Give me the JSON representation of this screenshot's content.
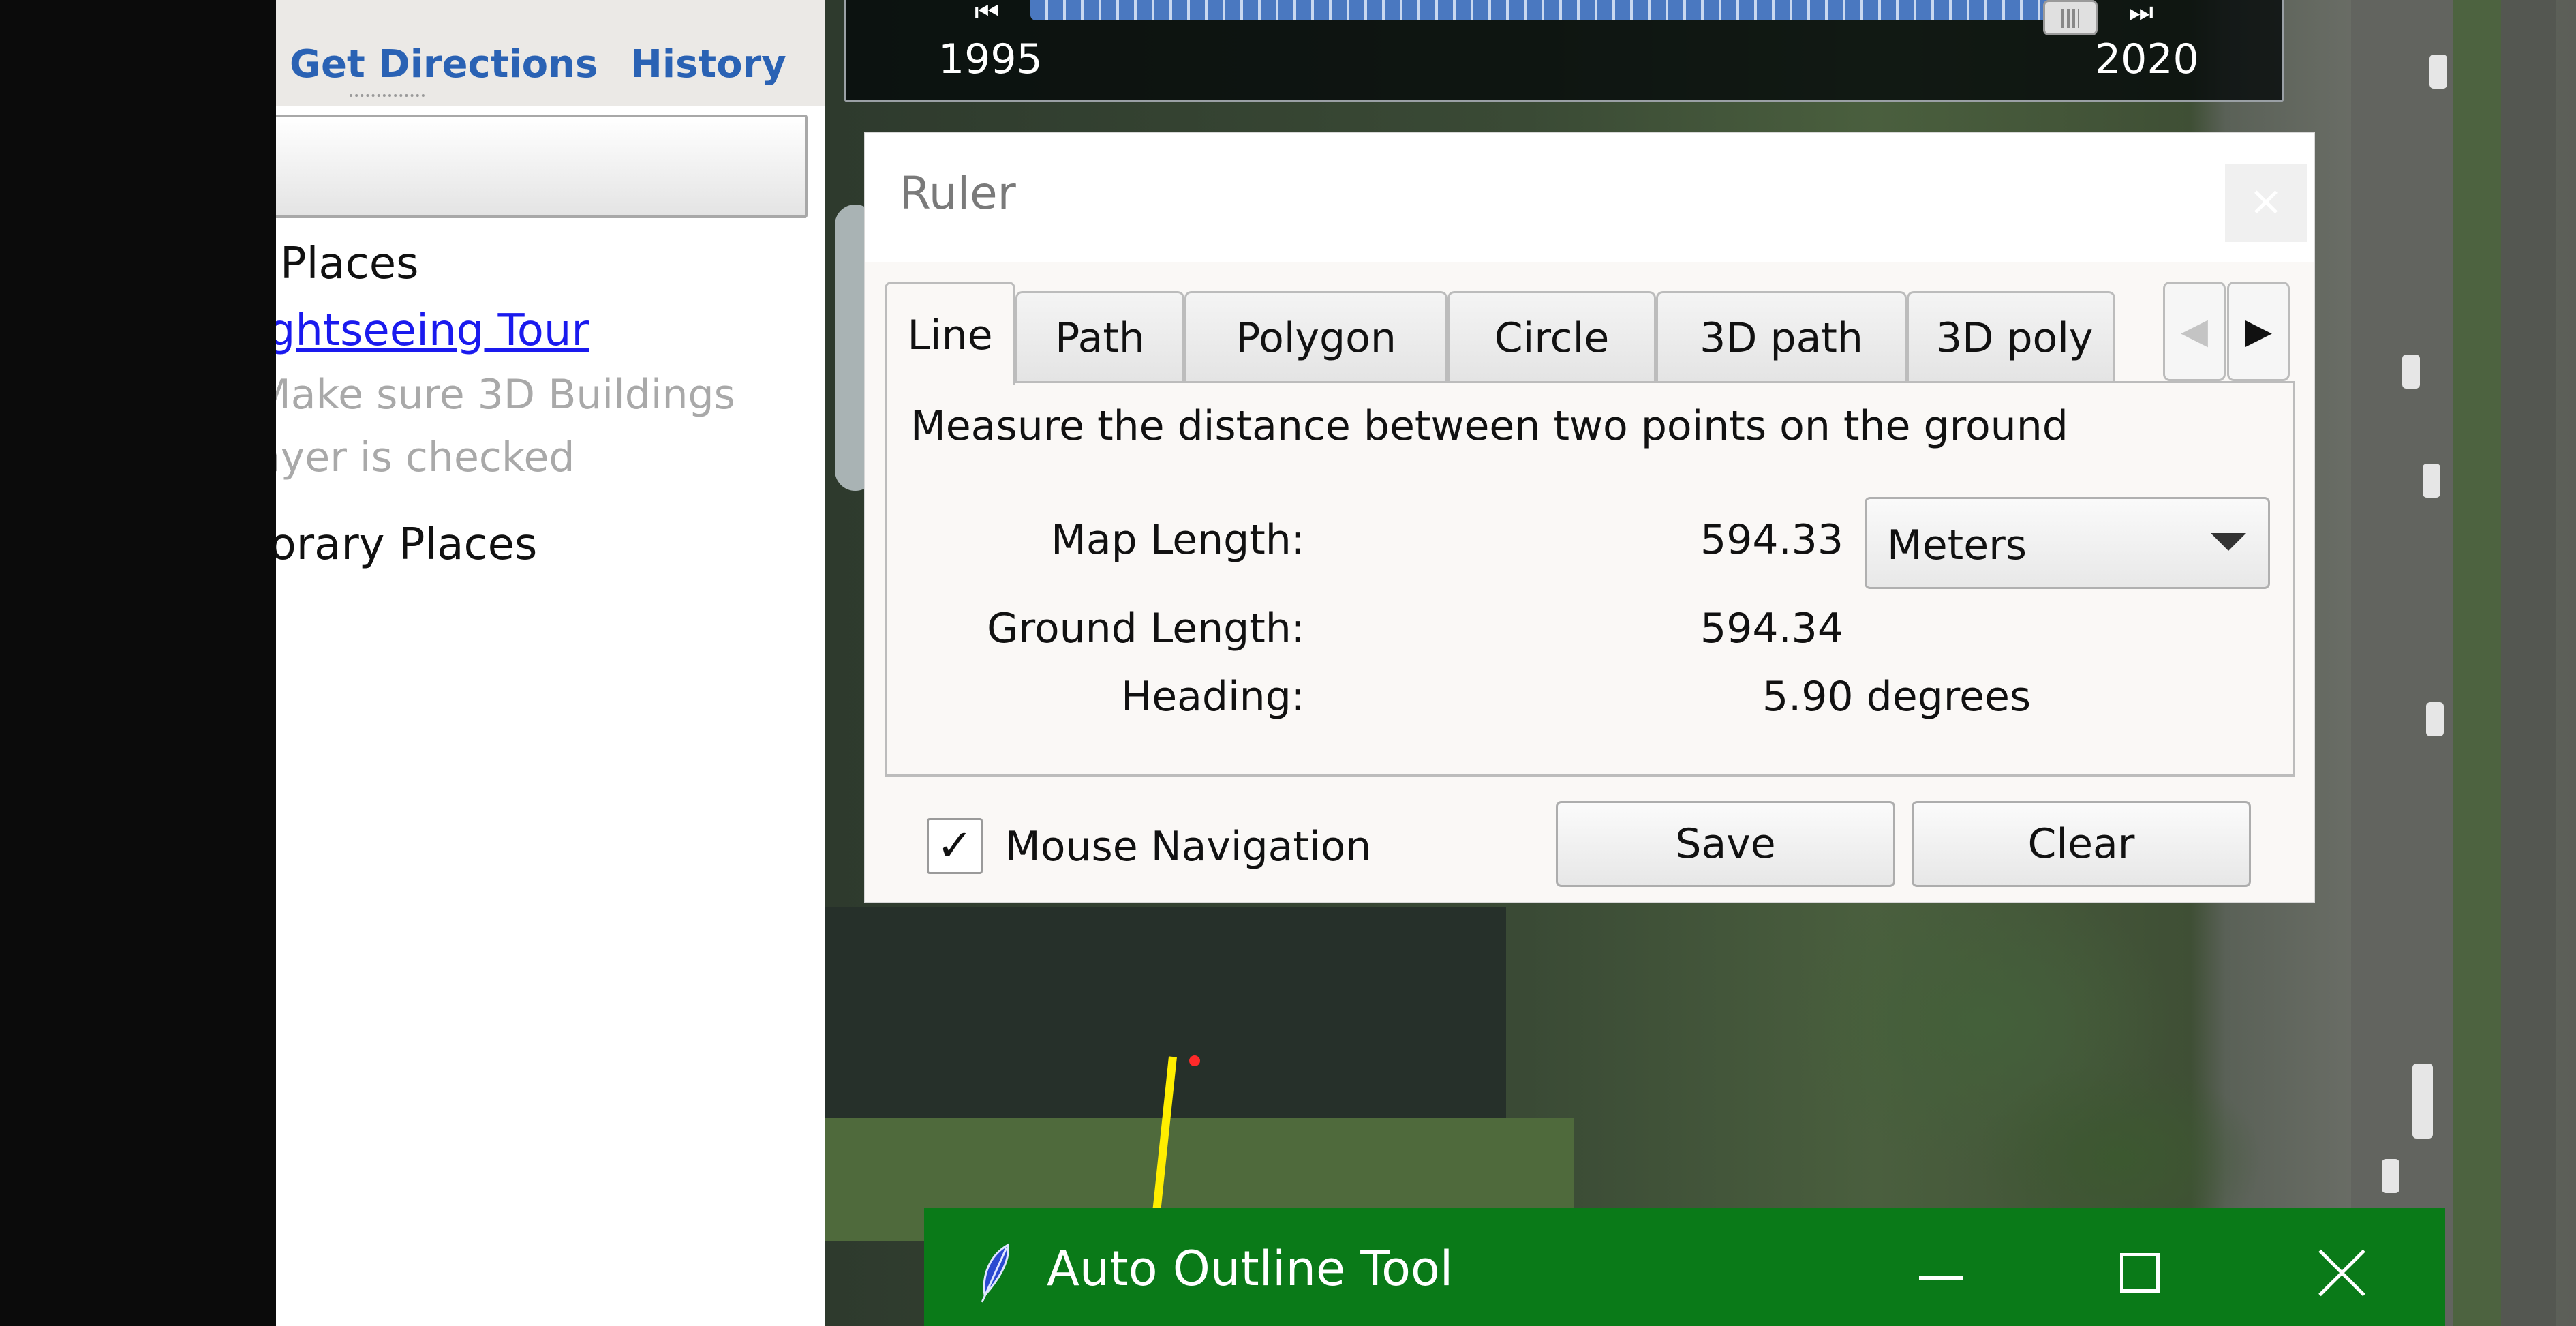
{
  "sidebar": {
    "tabs": {
      "directions": "Get Directions",
      "history": "History"
    },
    "places": "Places",
    "tour_link": "ightseeing Tour",
    "tour_note_line1": "Make sure 3D Buildings",
    "tour_note_line2": "ayer is checked",
    "temporary_places": "porary Places"
  },
  "historical_imagery": {
    "start_year": "1995",
    "end_year": "2020",
    "prev_icon": "step-back-icon",
    "next_icon": "step-forward-icon"
  },
  "ruler": {
    "title": "Ruler",
    "close_glyph": "×",
    "tabs": [
      "Line",
      "Path",
      "Polygon",
      "Circle",
      "3D path",
      "3D poly"
    ],
    "active_tab": "Line",
    "description": "Measure the distance between two points on the ground",
    "map_length_label": "Map Length:",
    "map_length_value": "594.33",
    "ground_length_label": "Ground Length:",
    "ground_length_value": "594.34",
    "heading_label": "Heading:",
    "heading_value": "5.90 degrees",
    "unit": "Meters",
    "mouse_navigation_label": "Mouse Navigation",
    "mouse_navigation_checked": true,
    "save_label": "Save",
    "clear_label": "Clear"
  },
  "auto_outline": {
    "title": "Auto Outline Tool",
    "accent": "#0a7a18"
  }
}
